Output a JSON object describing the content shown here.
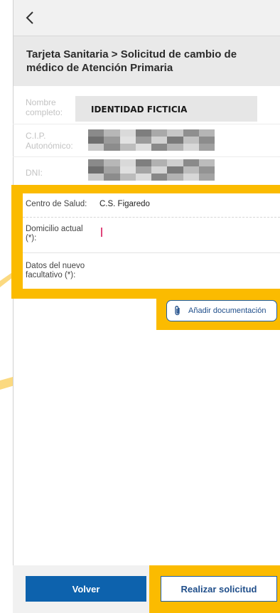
{
  "header": {
    "back_icon": "chevron-left-icon",
    "title": "Tarjeta Sanitaria > Solicitud de cambio de médico de Atención Primaria"
  },
  "identity": {
    "name_label": "Nombre completo:",
    "name_value": "IDENTIDAD FICTICIA",
    "cip_label": "C.I.P. Autonómico:",
    "dni_label": "DNI:"
  },
  "form": {
    "centro_label": "Centro de Salud:",
    "centro_value": "C.S. Figaredo",
    "domicilio_label": "Domicilio actual (*):",
    "facultativo_label": "Datos del nuevo facultativo (*):"
  },
  "attach": {
    "icon": "paperclip-icon",
    "label": "Añadir documentación"
  },
  "footer": {
    "back_label": "Volver",
    "submit_label": "Realizar solicitud"
  },
  "colors": {
    "highlight": "#fbbb00",
    "primary": "#0d62ad",
    "title_bg": "#e9e9e9"
  }
}
